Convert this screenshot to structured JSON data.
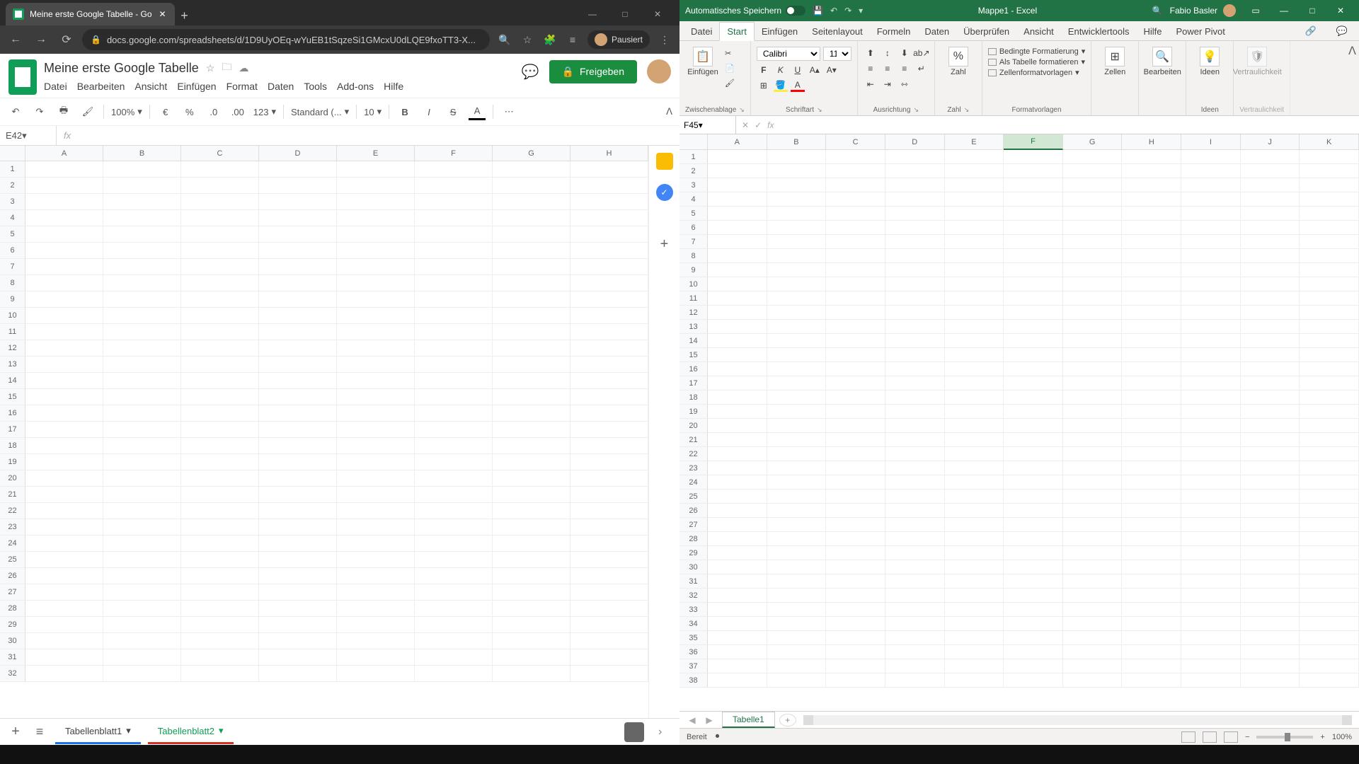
{
  "chrome": {
    "tab_title": "Meine erste Google Tabelle - Go",
    "url": "docs.google.com/spreadsheets/d/1D9UyOEq-wYuEB1tSqzeSi1GMcxU0dLQE9fxoTT3-X...",
    "user_status": "Pausiert"
  },
  "sheets": {
    "title": "Meine erste Google Tabelle",
    "menu": [
      "Datei",
      "Bearbeiten",
      "Ansicht",
      "Einfügen",
      "Format",
      "Daten",
      "Tools",
      "Add-ons",
      "Hilfe"
    ],
    "share_label": "Freigeben",
    "zoom": "100%",
    "format_select": "Standard (...",
    "font_size": "10",
    "currency": "€",
    "percent": "%",
    "dec0": ".0",
    "dec00": ".00",
    "num123": "123",
    "name_box": "E42",
    "fx": "fx",
    "columns": [
      "A",
      "B",
      "C",
      "D",
      "E",
      "F",
      "G",
      "H"
    ],
    "rows": [
      "1",
      "2",
      "3",
      "4",
      "5",
      "6",
      "7",
      "8",
      "9",
      "10",
      "11",
      "12",
      "13",
      "14",
      "15",
      "16",
      "17",
      "18",
      "19",
      "20",
      "21",
      "22",
      "23",
      "24",
      "25",
      "26",
      "27",
      "28",
      "29",
      "30",
      "31",
      "32"
    ],
    "sheet_tabs": [
      "Tabellenblatt1",
      "Tabellenblatt2"
    ]
  },
  "excel": {
    "autosave_label": "Automatisches Speichern",
    "title": "Mappe1 - Excel",
    "user_name": "Fabio Basler",
    "tabs": [
      "Datei",
      "Start",
      "Einfügen",
      "Seitenlayout",
      "Formeln",
      "Daten",
      "Überprüfen",
      "Ansicht",
      "Entwicklertools",
      "Hilfe",
      "Power Pivot"
    ],
    "ribbon": {
      "clipboard": {
        "paste": "Einfügen",
        "label": "Zwischenablage"
      },
      "font": {
        "name": "Calibri",
        "size": "11",
        "label": "Schriftart"
      },
      "alignment": {
        "label": "Ausrichtung"
      },
      "number": {
        "big": "%",
        "lbl": "Zahl",
        "label": "Zahl"
      },
      "styles": {
        "cond": "Bedingte Formatierung",
        "table": "Als Tabelle formatieren",
        "cell": "Zellenformatvorlagen",
        "label": "Formatvorlagen"
      },
      "cells": {
        "btn": "Zellen",
        "label": ""
      },
      "editing": {
        "btn": "Bearbeiten",
        "label": ""
      },
      "ideas": {
        "btn": "Ideen",
        "label": "Ideen"
      },
      "sensitivity": {
        "btn": "Vertraulichkeit",
        "label": "Vertraulichkeit"
      }
    },
    "name_box": "F45",
    "fx": "fx",
    "columns": [
      "A",
      "B",
      "C",
      "D",
      "E",
      "F",
      "G",
      "H",
      "I",
      "J",
      "K"
    ],
    "rows": [
      "1",
      "2",
      "3",
      "4",
      "5",
      "6",
      "7",
      "8",
      "9",
      "10",
      "11",
      "12",
      "13",
      "14",
      "15",
      "16",
      "17",
      "18",
      "19",
      "20",
      "21",
      "22",
      "23",
      "24",
      "25",
      "26",
      "27",
      "28",
      "29",
      "30",
      "31",
      "32",
      "33",
      "34",
      "35",
      "36",
      "37",
      "38"
    ],
    "sheet_tab": "Tabelle1",
    "status": "Bereit",
    "zoom": "100%"
  }
}
